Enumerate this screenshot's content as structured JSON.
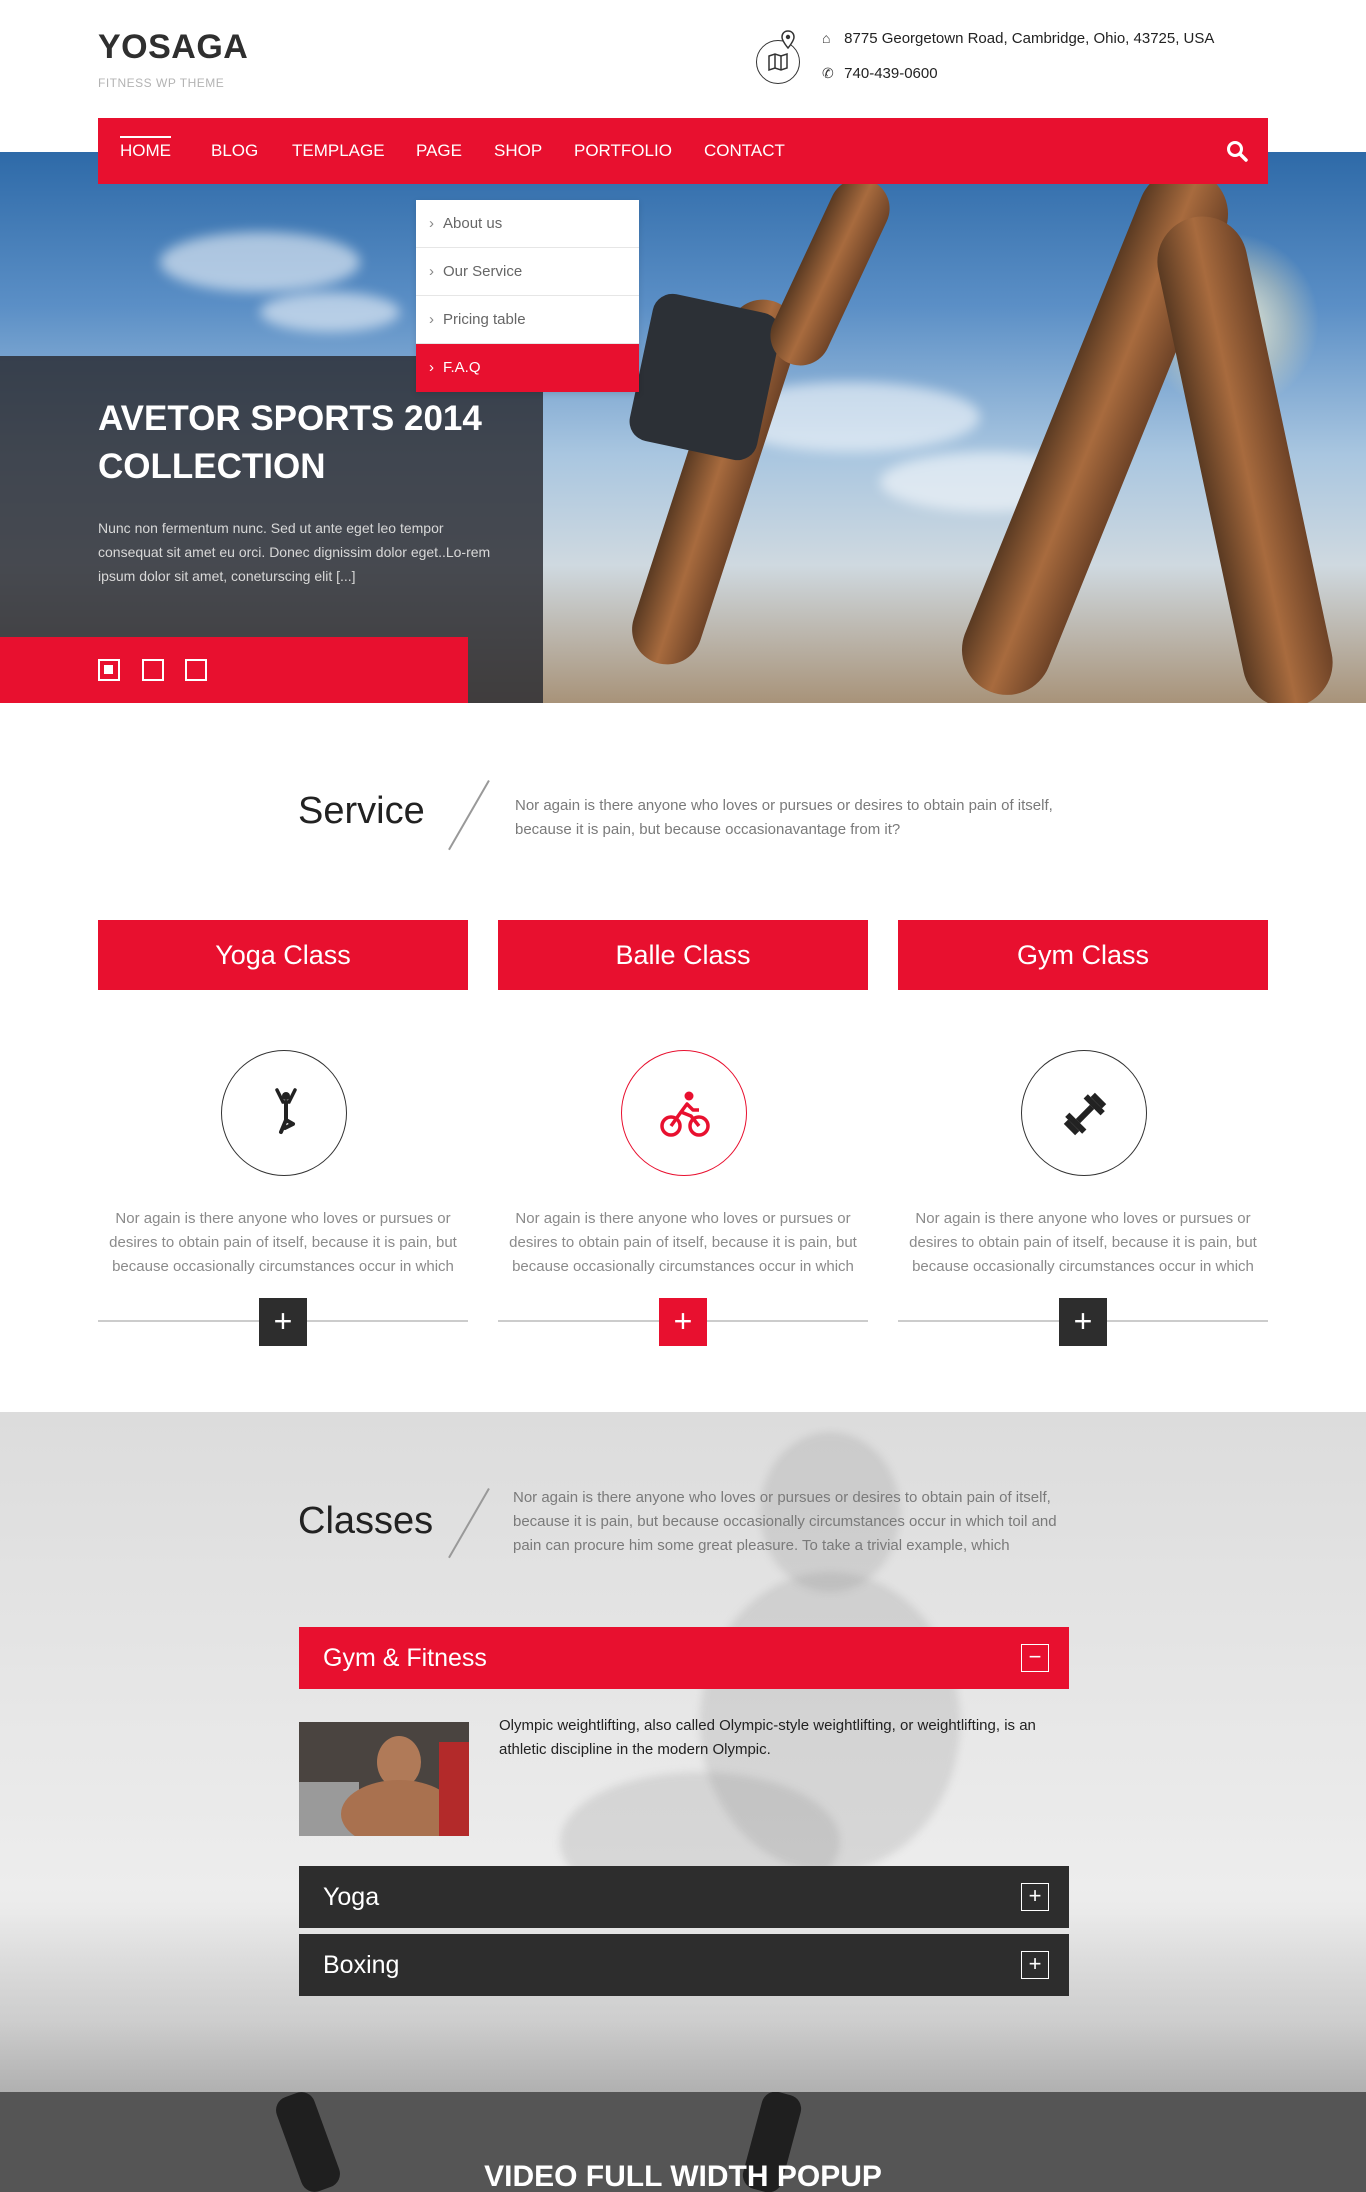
{
  "brand": {
    "logo": "YOSAGA",
    "tagline": "FITNESS WP THEME"
  },
  "contact": {
    "address": "8775 Georgetown Road, Cambridge, Ohio, 43725, USA",
    "phone": "740-439-0600"
  },
  "nav": {
    "items": [
      "HOME",
      "BLOG",
      "TEMPLAGE",
      "PAGE",
      "SHOP",
      "PORTFOLIO",
      "CONTACT"
    ],
    "active": "HOME",
    "dropdown": [
      "About us",
      "Our Service",
      "Pricing table",
      "F.A.Q"
    ],
    "dropdown_active": "F.A.Q"
  },
  "hero": {
    "title": "AVETOR SPORTS 2014 COLLECTION",
    "text": "Nunc non fermentum nunc. Sed ut ante eget leo tempor consequat sit amet eu orci. Donec dignissim dolor eget..Lo-rem ipsum dolor sit amet, coneturscing elit  [...]",
    "slides": 3,
    "active_slide": 1
  },
  "service": {
    "title": "Service",
    "description": "Nor again is there anyone who loves or pursues or desires to obtain pain of itself, because it is pain, but because occasionavantage from it?",
    "cards": [
      {
        "label": "Yoga Class",
        "icon": "yoga-icon",
        "text": "Nor again is there anyone who loves or pursues or desires to obtain pain of itself, because it is pain, but because occasionally circumstances occur in which"
      },
      {
        "label": "Balle Class",
        "icon": "cyclist-icon",
        "text": "Nor again is there anyone who loves or pursues or desires to obtain pain of itself, because it is pain, but because occasionally circumstances occur in which"
      },
      {
        "label": "Gym Class",
        "icon": "dumbbell-icon",
        "text": "Nor again is there anyone who loves or pursues or desires to obtain pain of itself, because it is pain, but because occasionally circumstances occur in which"
      }
    ]
  },
  "classes": {
    "title": "Classes",
    "description": "Nor again is there anyone who loves or pursues or desires to obtain pain of itself, because it is pain, but because occasionally circumstances occur in which toil and pain can procure him some great pleasure. To take a trivial example, which",
    "items": [
      {
        "label": "Gym & Fitness",
        "open": true,
        "text": "Olympic weightlifting, also called Olympic-style weightlifting, or weightlifting, is an athletic discipline in the modern Olympic."
      },
      {
        "label": "Yoga",
        "open": false
      },
      {
        "label": "Boxing",
        "open": false
      }
    ]
  },
  "video": {
    "title": "VIDEO FULL WIDTH POPUP"
  },
  "colors": {
    "accent": "#e8102f",
    "dark": "#2d2d2d",
    "text": "#333333",
    "muted": "#8a8a8a"
  }
}
